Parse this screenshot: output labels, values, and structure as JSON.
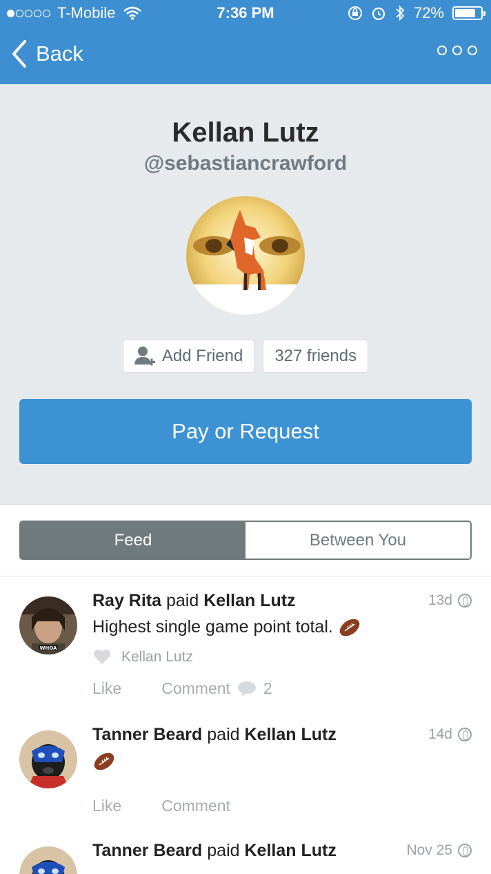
{
  "status_bar": {
    "carrier": "T-Mobile",
    "time": "7:36 PM",
    "battery": "72%",
    "battery_level": 0.72,
    "signal_bars_filled": 1
  },
  "nav": {
    "back_label": "Back"
  },
  "profile": {
    "name": "Kellan Lutz",
    "handle": "@sebastiancrawford",
    "add_friend_label": "Add Friend",
    "friends_count_label": "327 friends",
    "pay_label": "Pay or Request"
  },
  "tabs": [
    {
      "label": "Feed",
      "active": true
    },
    {
      "label": "Between You",
      "active": false
    }
  ],
  "feed": [
    {
      "actor": "Ray Rita",
      "verb": "paid",
      "target": "Kellan Lutz",
      "time": "13d",
      "message": "Highest single game point total.",
      "liked_by": "Kellan Lutz",
      "like_label": "Like",
      "comment_label": "Comment",
      "comment_count": "2"
    },
    {
      "actor": "Tanner Beard",
      "verb": "paid",
      "target": "Kellan Lutz",
      "time": "14d",
      "message": "",
      "like_label": "Like",
      "comment_label": "Comment"
    },
    {
      "actor": "Tanner Beard",
      "verb": "paid",
      "target": "Kellan Lutz",
      "time": "Nov 25"
    }
  ],
  "colors": {
    "brand_blue": "#3d8fd1",
    "profile_bg": "#e7eaed",
    "tab_active": "#6f7a7c",
    "muted_text": "#9aa3a7"
  }
}
